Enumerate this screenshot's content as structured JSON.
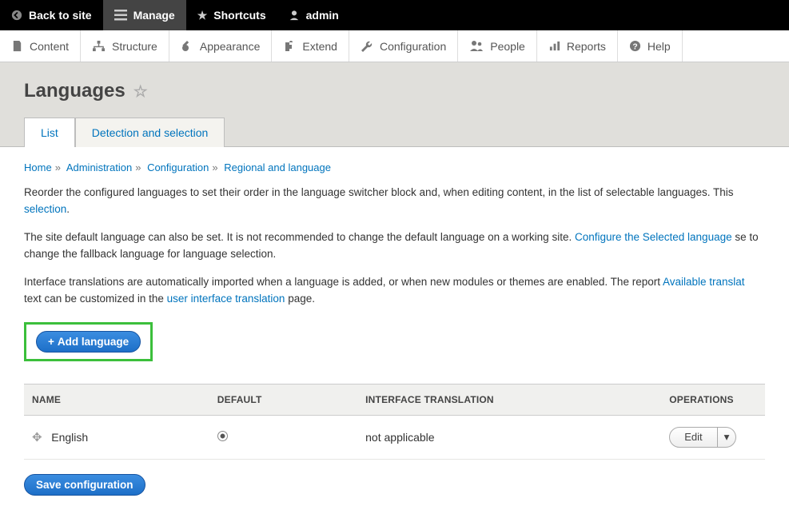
{
  "toolbar": {
    "back": "Back to site",
    "manage": "Manage",
    "shortcuts": "Shortcuts",
    "user": "admin"
  },
  "admin_menu": {
    "content": "Content",
    "structure": "Structure",
    "appearance": "Appearance",
    "extend": "Extend",
    "configuration": "Configuration",
    "people": "People",
    "reports": "Reports",
    "help": "Help"
  },
  "page": {
    "title": "Languages"
  },
  "tabs": {
    "list": "List",
    "detection": "Detection and selection"
  },
  "breadcrumb": {
    "home": "Home",
    "admin": "Administration",
    "config": "Configuration",
    "regional": "Regional and language"
  },
  "desc": {
    "p1a": "Reorder the configured languages to set their order in the language switcher block and, when editing content, in the list of selectable languages. This ",
    "p1_link": "selection",
    "p1b": ".",
    "p2a": "The site default language can also be set. It is not recommended to change the default language on a working site. ",
    "p2_link": "Configure the Selected language",
    "p2b": " se to change the fallback language for language selection.",
    "p3a": "Interface translations are automatically imported when a language is added, or when new modules or themes are enabled. The report ",
    "p3_link1": "Available translat",
    "p3b": " text can be customized in the ",
    "p3_link2": "user interface translation",
    "p3c": " page."
  },
  "buttons": {
    "add_language": "Add language",
    "save_config": "Save configuration",
    "edit": "Edit"
  },
  "table": {
    "headers": {
      "name": "NAME",
      "default": "DEFAULT",
      "interface": "INTERFACE TRANSLATION",
      "operations": "OPERATIONS"
    },
    "rows": [
      {
        "name": "English",
        "default_checked": true,
        "interface": "not applicable"
      }
    ]
  }
}
